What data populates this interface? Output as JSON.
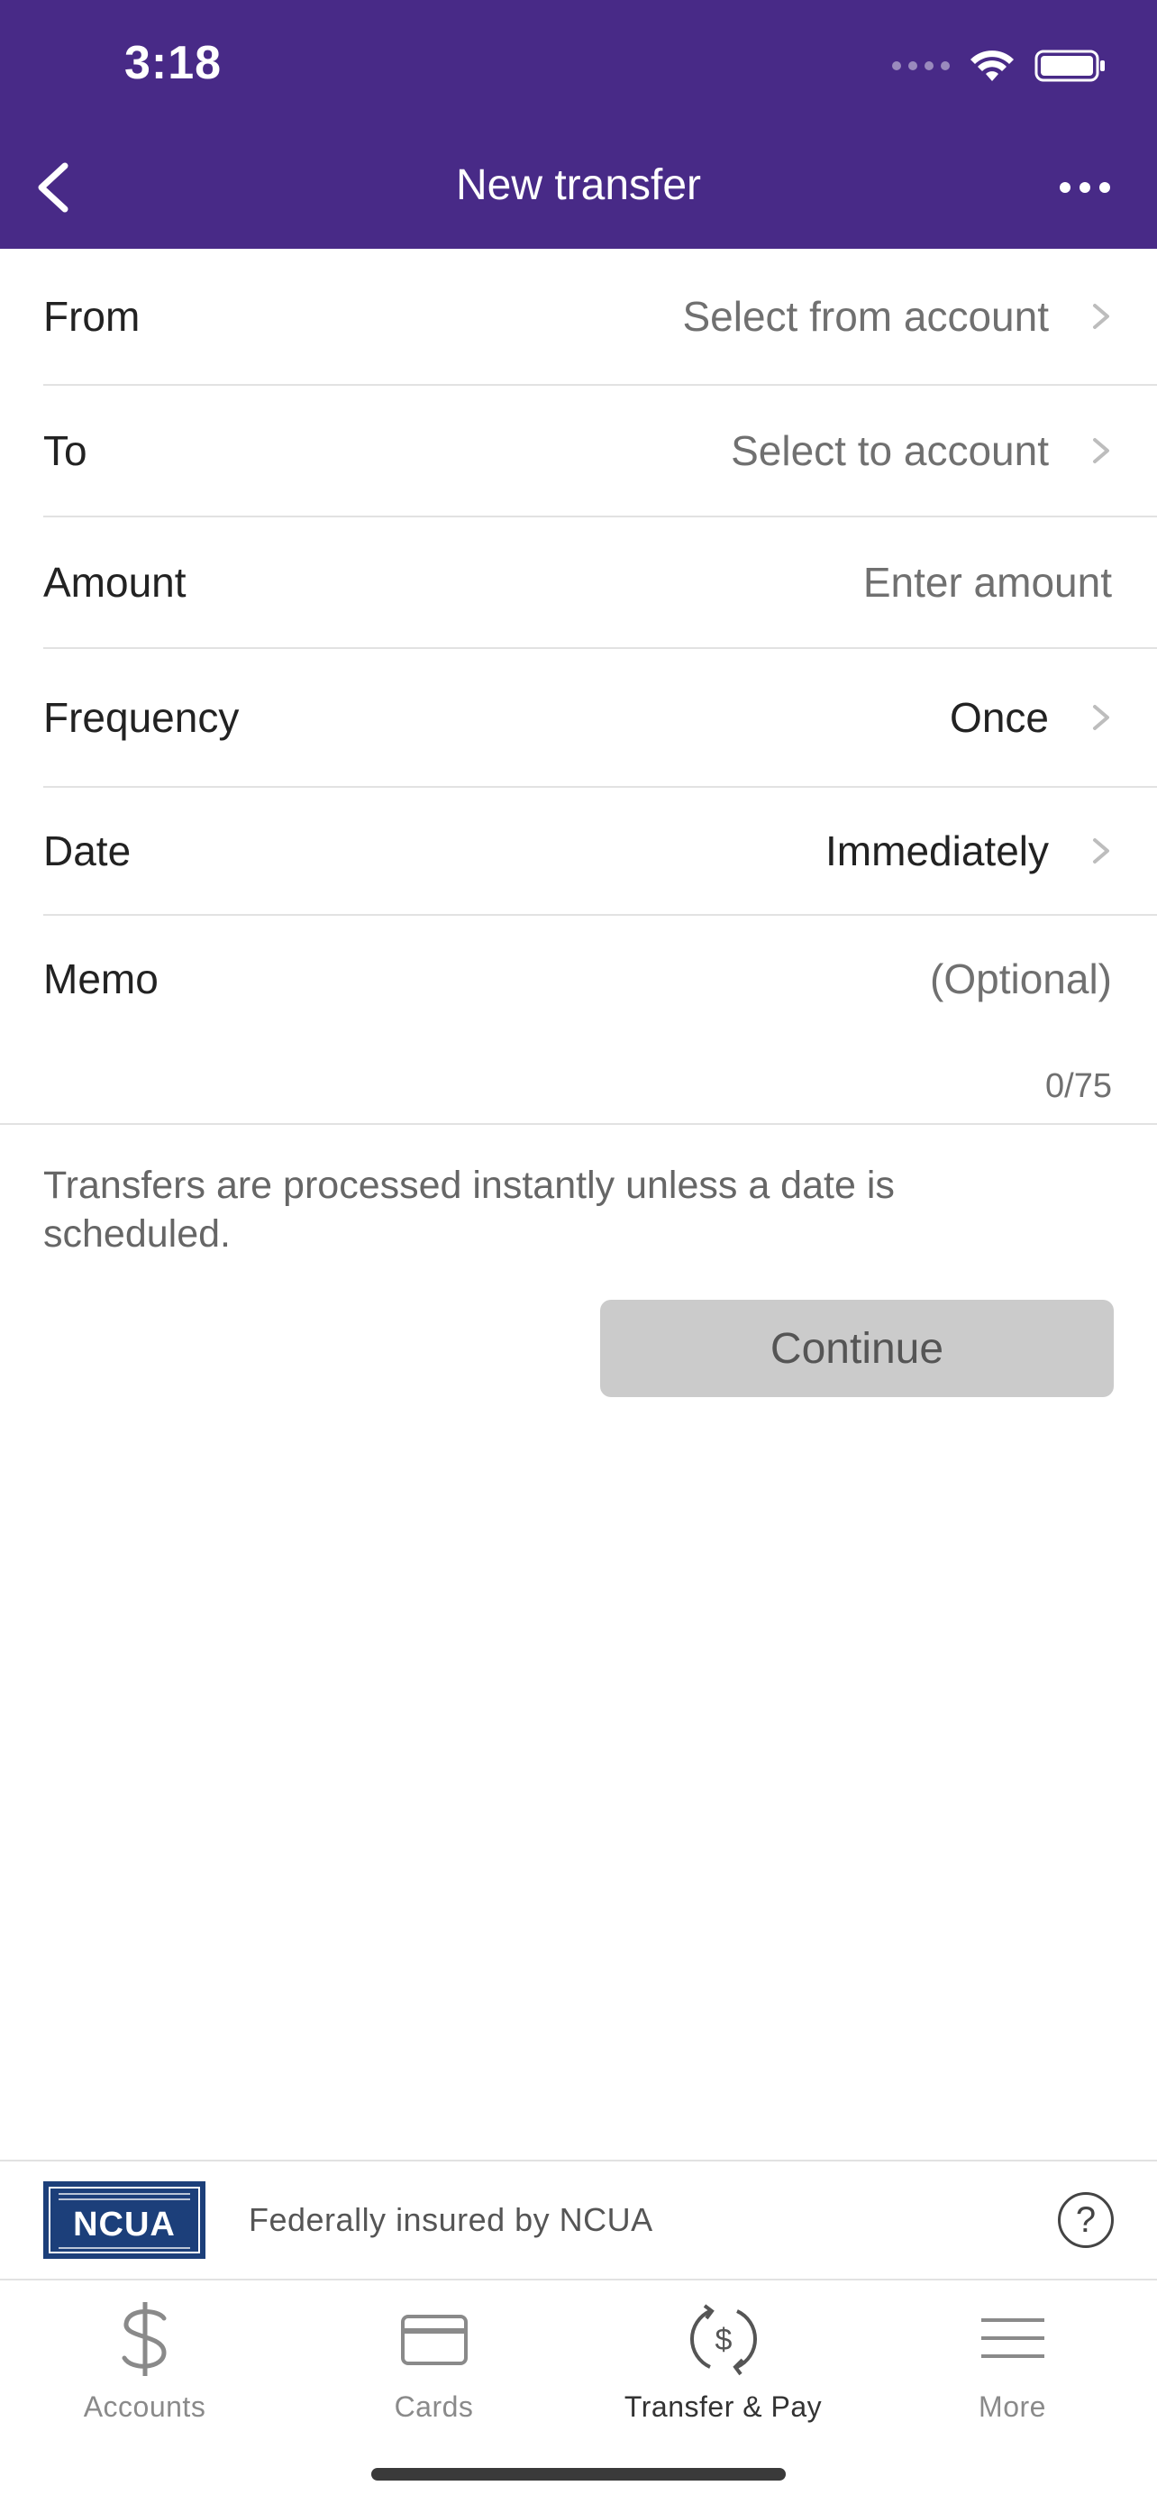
{
  "status_bar": {
    "time": "3:18"
  },
  "nav": {
    "title": "New transfer"
  },
  "form": {
    "from": {
      "label": "From",
      "value": "Select from account"
    },
    "to": {
      "label": "To",
      "value": "Select to account"
    },
    "amount": {
      "label": "Amount",
      "placeholder": "Enter amount"
    },
    "frequency": {
      "label": "Frequency",
      "value": "Once"
    },
    "date": {
      "label": "Date",
      "value": "Immediately"
    },
    "memo": {
      "label": "Memo",
      "placeholder": "(Optional)",
      "counter": "0/75"
    }
  },
  "info": {
    "text": "Transfers are processed instantly unless a date is scheduled."
  },
  "continue_button": {
    "label": "Continue"
  },
  "ncua": {
    "logo_text": "NCUA",
    "text": "Federally insured by NCUA"
  },
  "tabs": [
    {
      "label": "Accounts",
      "icon": "dollar-icon",
      "active": false
    },
    {
      "label": "Cards",
      "icon": "card-icon",
      "active": false
    },
    {
      "label": "Transfer & Pay",
      "icon": "transfer-pay-icon",
      "active": true
    },
    {
      "label": "More",
      "icon": "menu-icon",
      "active": false
    }
  ],
  "colors": {
    "header": "#482a87",
    "button_disabled": "#cbcbcb",
    "ncua_blue": "#1c3f7a"
  }
}
